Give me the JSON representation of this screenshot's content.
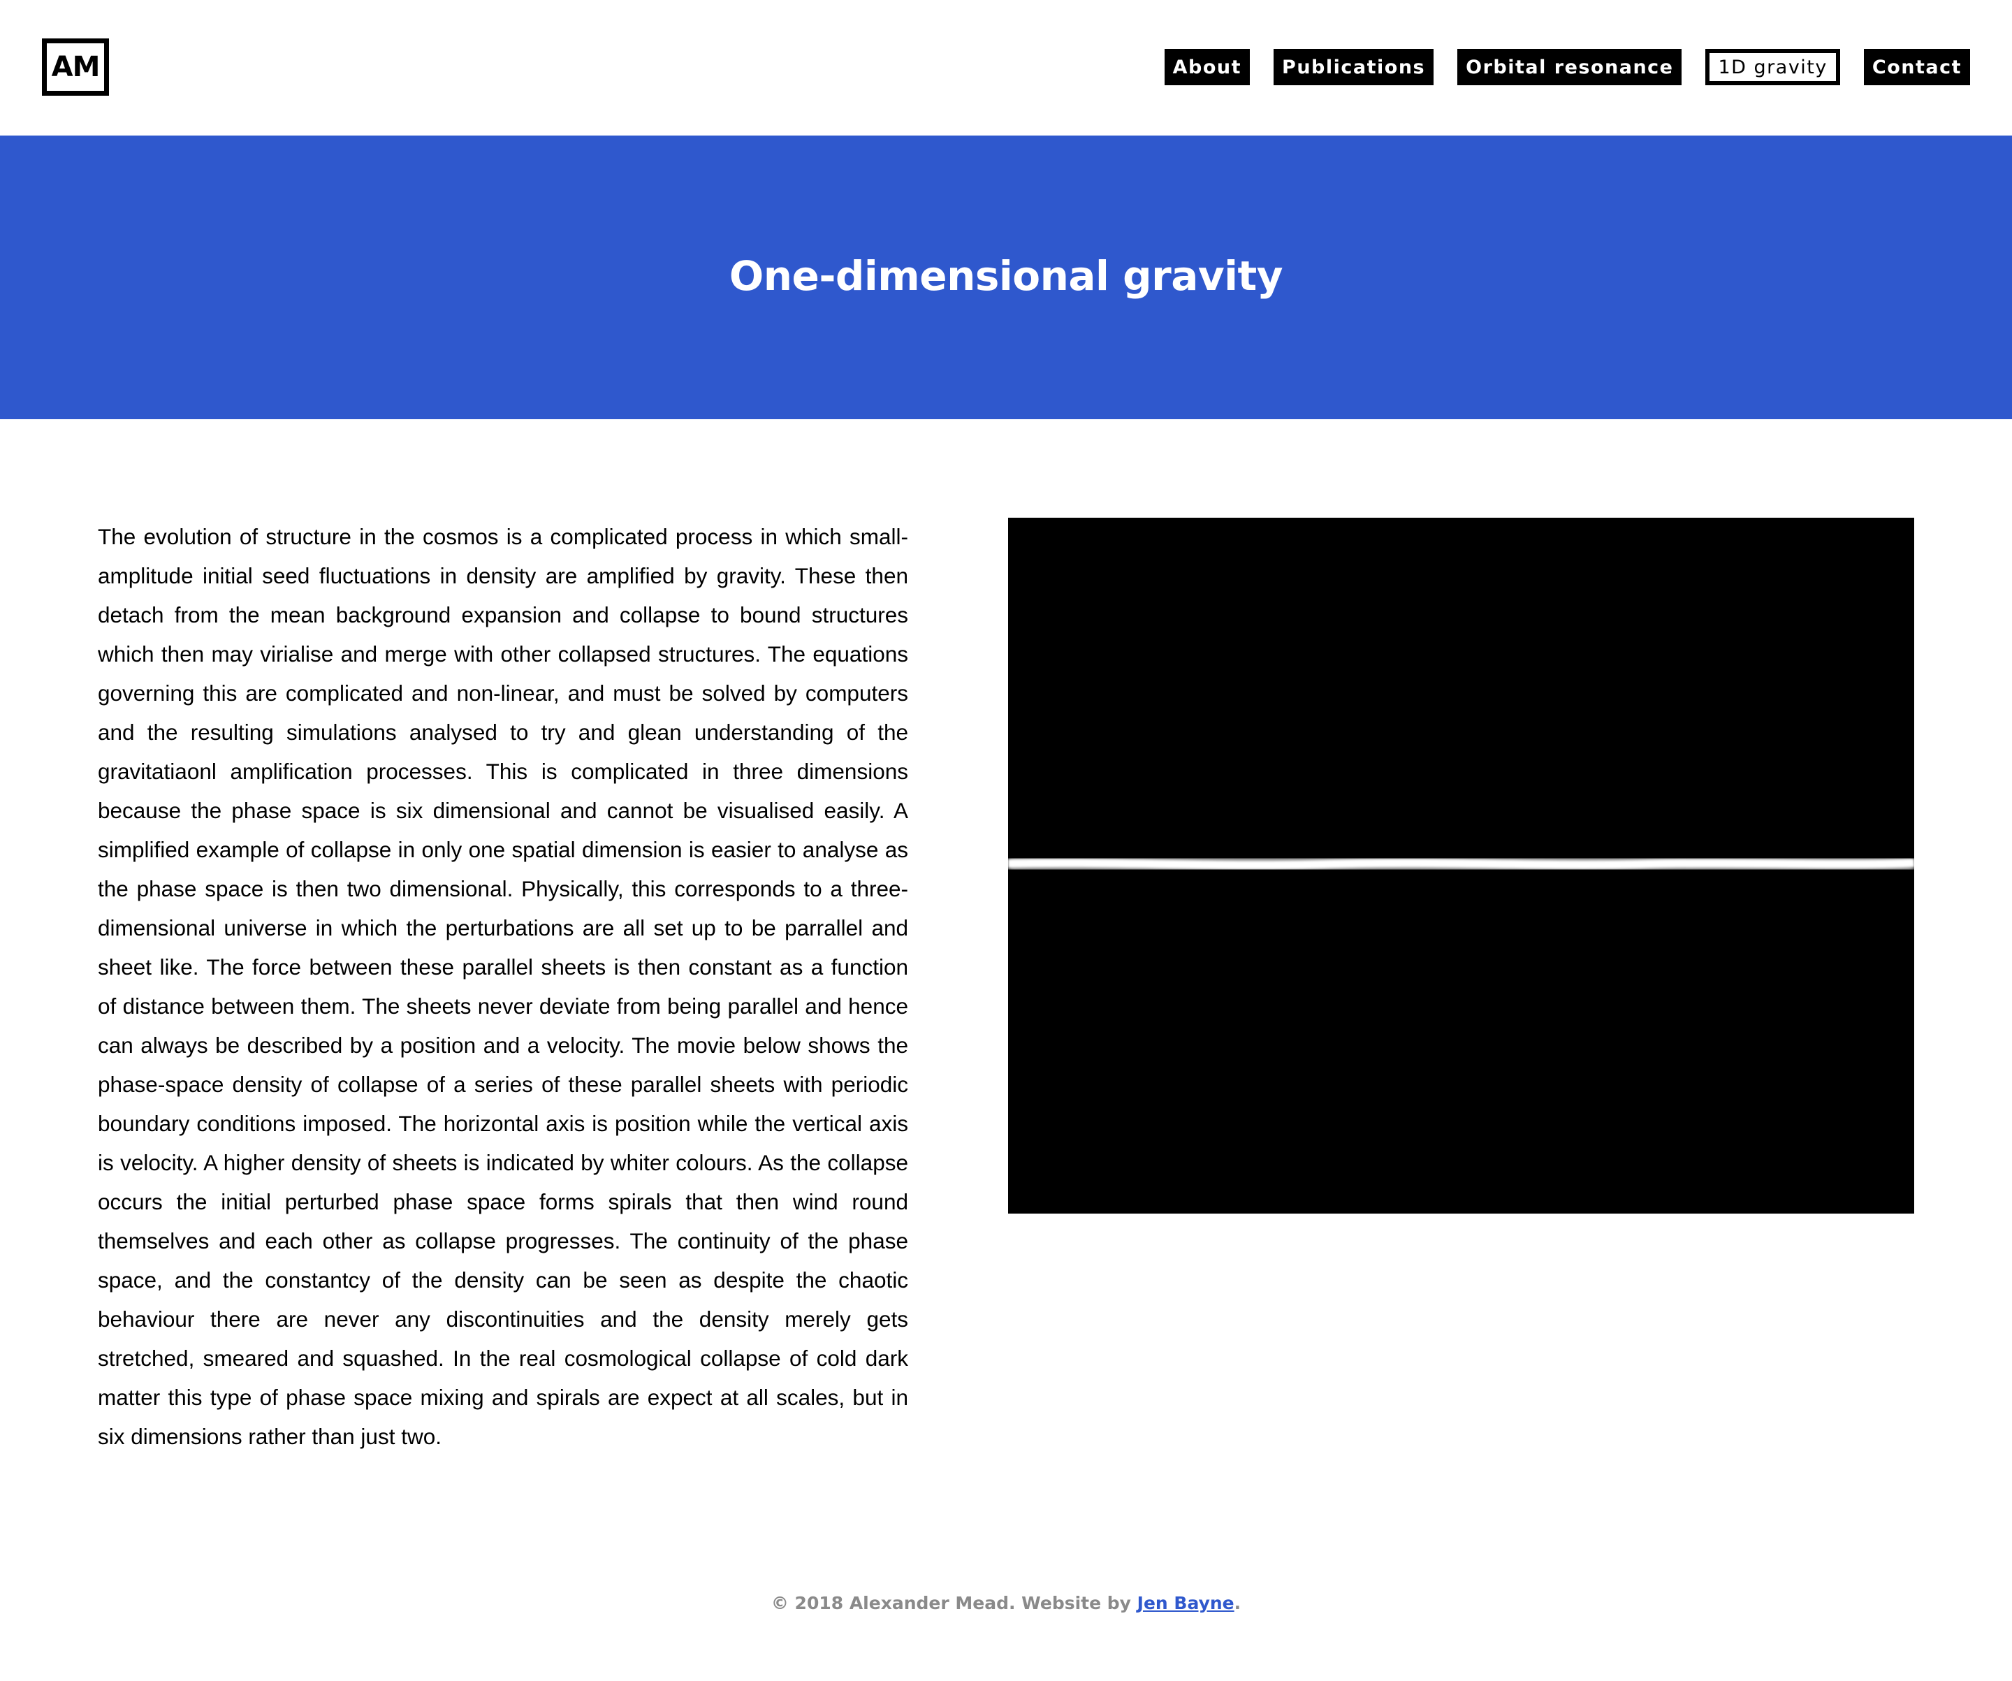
{
  "header": {
    "logo_text": "AM",
    "nav": [
      {
        "label": "About",
        "active": false
      },
      {
        "label": "Publications",
        "active": false
      },
      {
        "label": "Orbital resonance",
        "active": false
      },
      {
        "label": "1D gravity",
        "active": true
      },
      {
        "label": "Contact",
        "active": false
      }
    ]
  },
  "hero": {
    "title": "One-dimensional gravity",
    "background_color": "#2f58cd"
  },
  "main": {
    "body_text": "The evolution of structure in the cosmos is a complicated process in which small-amplitude initial seed fluctuations in density are amplified by gravity. These then detach from the mean background expansion and collapse to bound structures which then may virialise and merge with other collapsed structures. The equations governing this are complicated and non-linear, and must be solved by computers and the resulting simulations analysed to try and glean understanding of the gravitatiaonl amplification processes. This is complicated in three dimensions because the phase space is six dimensional and cannot be visualised easily. A simplified example of collapse in only one spatial dimension is easier to analyse as the phase space is then two dimensional. Physically, this corresponds to a three-dimensional universe in which the perturbations are all set up to be parrallel and sheet like. The force between these parallel sheets is then constant as a function of distance between them. The sheets never deviate from being parallel and hence can always be described by a position and a velocity. The movie below shows the phase-space density of collapse of a series of these parallel sheets with periodic boundary conditions imposed. The horizontal axis is position while the vertical axis is velocity. A higher density of sheets is indicated by whiter colours. As the collapse occurs the initial perturbed phase space forms spirals that then wind round themselves and each other as collapse progresses. The continuity of the phase space, and the constantcy of the density can be seen as despite the chaotic behaviour there are never any discontinuities and the density merely gets stretched, smeared and squashed. In the real cosmological collapse of cold dark matter this type of phase space mixing and spirals are expect at all scales, but in six dimensions rather than just two."
  },
  "footer": {
    "copyright": "© 2018 Alexander Mead. Website by ",
    "credit_link": "Jen Bayne",
    "end": "."
  },
  "colors": {
    "accent": "#2f58cd",
    "footer_text": "#8a8a8a"
  }
}
